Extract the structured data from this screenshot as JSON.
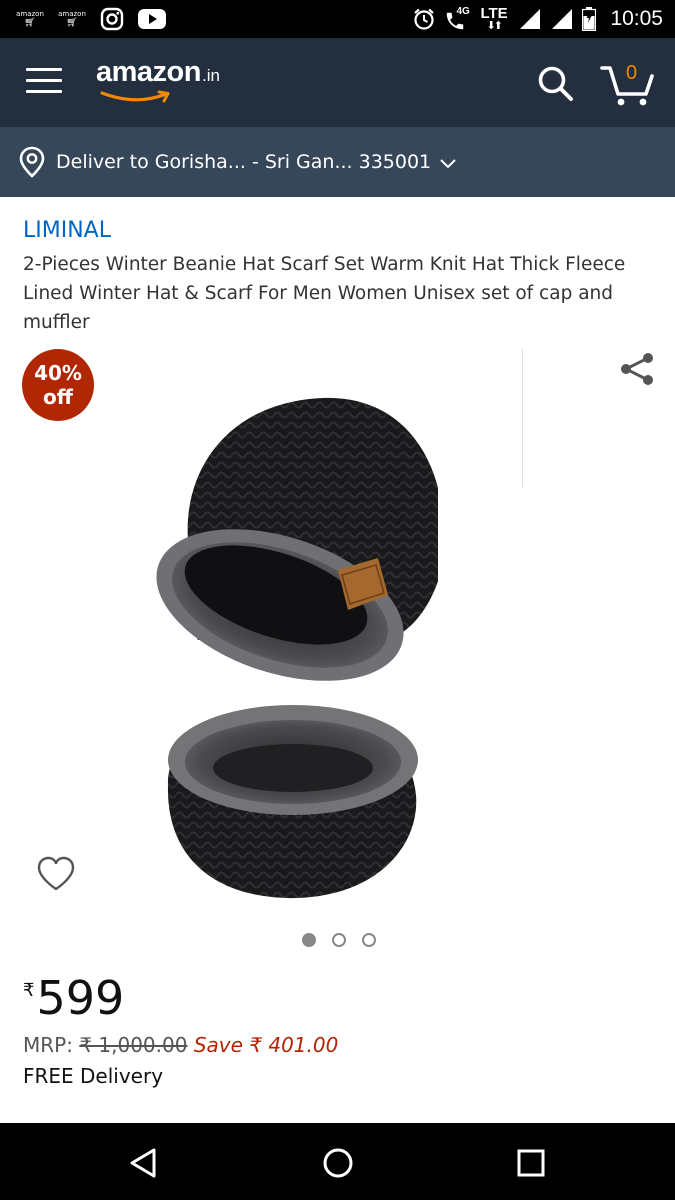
{
  "status_bar": {
    "time": "10:05",
    "apps": [
      {
        "label": "amazon",
        "icon": "amazon-shopping-app-icon"
      },
      {
        "label": "amazon",
        "icon": "amazon-shopping-app-icon"
      },
      {
        "label": "",
        "icon": "instagram-icon"
      },
      {
        "label": "",
        "icon": "youtube-icon"
      }
    ],
    "network_4g": "4G",
    "network_lte": "LTE"
  },
  "header": {
    "logo_word": "amazon",
    "logo_tld": ".in",
    "cart_count": "0",
    "brand_color": "#232f3e",
    "accent_color": "#f08804"
  },
  "deliver": {
    "text": "Deliver to Gorisha... - Sri Gan... 335001"
  },
  "product": {
    "brand": "LIMINAL",
    "title": "2-Pieces Winter Beanie Hat Scarf Set Warm Knit Hat Thick Fleece Lined Winter Hat & Scarf For Men Women Unisex set of cap and muffler",
    "discount_badge": {
      "line1": "40%",
      "line2": "off",
      "color": "#b12704"
    },
    "image_dots": {
      "count": 3,
      "active_index": 0
    },
    "price_symbol": "₹",
    "price": "599",
    "mrp_label": "MRP:",
    "mrp_value": "₹ 1,000.00",
    "save_text": "Save ₹ 401.00",
    "delivery": "FREE Delivery"
  }
}
